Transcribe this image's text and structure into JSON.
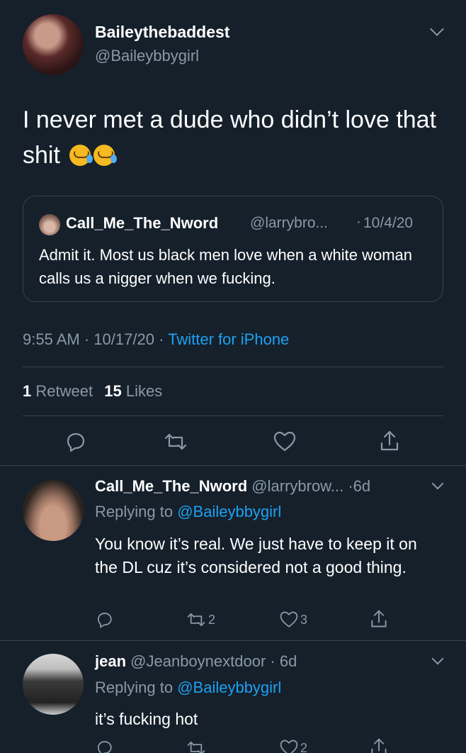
{
  "main_tweet": {
    "display_name": "Baileythebaddest",
    "handle": "@Baileybbygirl",
    "text": "I never met a dude who didn’t love that shit",
    "emojis": [
      "rolling-on-floor-laughing",
      "rolling-on-floor-laughing"
    ],
    "time": "9:55 AM",
    "date": "10/17/20",
    "source": "Twitter for iPhone",
    "retweet_count": "1",
    "retweet_label": "Retweet",
    "like_count": "15",
    "like_label": "Likes"
  },
  "quoted_tweet": {
    "display_name": "Call_Me_The_Nword",
    "handle": "@larrybro...",
    "date": "10/4/20",
    "text": "Admit it. Most us black men love when a white woman calls us a nigger when we fucking."
  },
  "replies": [
    {
      "display_name": "Call_Me_The_Nword",
      "handle": "@larrybrow...",
      "age": "6d",
      "replying_to_label": "Replying to",
      "replying_to": "@Baileybbygirl",
      "text": "You know it’s real. We just have to keep it on the DL cuz it’s considered not a good thing.",
      "reply_count": "",
      "retweet_count": "2",
      "like_count": "3"
    },
    {
      "display_name": "jean",
      "handle": "@Jeanboynextdoor",
      "age": "6d",
      "replying_to_label": "Replying to",
      "replying_to": "@Baileybbygirl",
      "text": "it’s fucking hot",
      "reply_count": "",
      "retweet_count": "",
      "like_count": "2"
    }
  ],
  "colors": {
    "background": "#15202b",
    "link": "#1da1f2",
    "muted": "#8899a6",
    "divider": "#38444d"
  }
}
